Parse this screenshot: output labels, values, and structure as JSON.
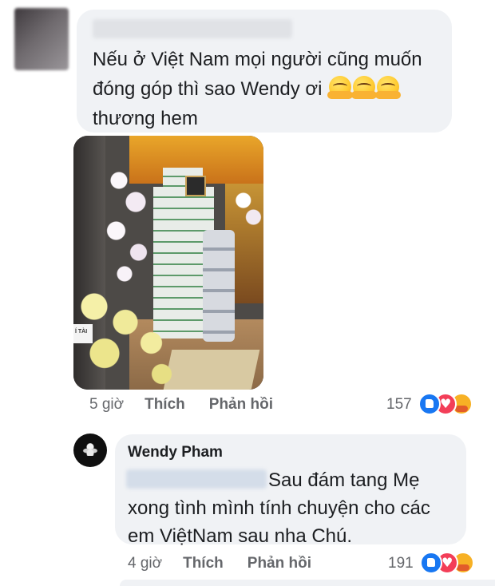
{
  "comment1": {
    "text": "Nếu ở Việt Nam mọi người cũng muốn đóng góp thì sao Wendy ơi",
    "text_after_emoji": "thương hem",
    "emojis": [
      "hugging-face-icon",
      "hugging-face-icon",
      "hugging-face-icon"
    ],
    "photo_sign_text": "Í TÀI",
    "time": "5 giờ",
    "like_label": "Thích",
    "reply_label": "Phản hồi",
    "reaction_count": "157",
    "reactions": [
      "like-icon",
      "love-icon",
      "care-icon"
    ]
  },
  "comment2": {
    "author": "Wendy Pham",
    "text": "Sau đám tang Mẹ xong tình mình tính chuyện cho các em ViệtNam sau nha Chú.",
    "line1": "Sau đám tang Mẹ",
    "line2": "xong tình mình tính chuyện cho các",
    "line3": "em ViệtNam sau nha Chú.",
    "time": "4 giờ",
    "like_label": "Thích",
    "reply_label": "Phản hồi",
    "reaction_count": "191",
    "reactions": [
      "like-icon",
      "love-icon",
      "care-icon"
    ]
  },
  "colors": {
    "bubble": "#f0f2f5",
    "meta_text": "#65676b",
    "like": "#1877f2",
    "love": "#f33e58",
    "care": "#f7b125"
  }
}
